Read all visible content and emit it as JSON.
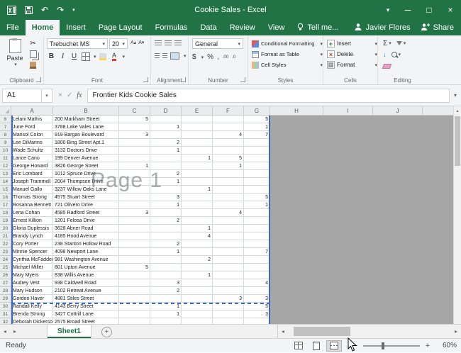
{
  "title_bar": {
    "title": "Cookie Sales - Excel"
  },
  "ribbon_tabs": [
    {
      "label": "File",
      "active": false
    },
    {
      "label": "Home",
      "active": true
    },
    {
      "label": "Insert",
      "active": false
    },
    {
      "label": "Page Layout",
      "active": false
    },
    {
      "label": "Formulas",
      "active": false
    },
    {
      "label": "Data",
      "active": false
    },
    {
      "label": "Review",
      "active": false
    },
    {
      "label": "View",
      "active": false
    }
  ],
  "tell_me": "Tell me...",
  "user_name": "Javier Flores",
  "share_label": "Share",
  "ribbon": {
    "clipboard": {
      "label": "Clipboard",
      "paste_label": "Paste"
    },
    "font": {
      "label": "Font",
      "font_name": "Trebuchet MS",
      "font_size": "20"
    },
    "alignment": {
      "label": "Alignment"
    },
    "number": {
      "label": "Number",
      "format": "General"
    },
    "styles": {
      "label": "Styles",
      "items": [
        "Conditional Formatting",
        "Format as Table",
        "Cell Styles"
      ]
    },
    "cells": {
      "label": "Cells",
      "items": [
        "Insert",
        "Delete",
        "Format"
      ]
    },
    "editing": {
      "label": "Editing"
    }
  },
  "formula_bar": {
    "name_box": "A1",
    "formula": "Frontier Kids Cookie Sales"
  },
  "sheet": {
    "columns": [
      "A",
      "B",
      "C",
      "D",
      "E",
      "F",
      "G",
      "H",
      "I",
      "J"
    ],
    "watermark": "Page 1",
    "page_break_after_row": 29,
    "rows": [
      {
        "n": 6,
        "cells": [
          "Lelani Mathis",
          "200 Markham Street",
          "5",
          "",
          "",
          "",
          "5"
        ]
      },
      {
        "n": 7,
        "cells": [
          "June Ford",
          "3788 Lake Vales Lane",
          "",
          "1",
          "",
          "",
          "1"
        ]
      },
      {
        "n": 8,
        "cells": [
          "Marisol Colon",
          "919 Bargan Boulevard",
          "3",
          "",
          "",
          "4",
          "7"
        ]
      },
      {
        "n": 9,
        "cells": [
          "Lee DiMarino",
          "1800 Bing Street Apt.1",
          "",
          "2",
          "",
          "",
          ""
        ]
      },
      {
        "n": 10,
        "cells": [
          "Wade Schultz",
          "3132 Doctors Drive",
          "",
          "1",
          "",
          "",
          ""
        ]
      },
      {
        "n": 11,
        "cells": [
          "Lance Cano",
          "199 Denver Avenue",
          "",
          "",
          "1",
          "5",
          ""
        ]
      },
      {
        "n": 12,
        "cells": [
          "George Howard",
          "3826 George Street",
          "1",
          "",
          "",
          "1",
          ""
        ]
      },
      {
        "n": 13,
        "cells": [
          "Eric Lombard",
          "1012 Spruce Drive",
          "",
          "2",
          "",
          "",
          ""
        ]
      },
      {
        "n": 14,
        "cells": [
          "Joseph Trammell",
          "2004 Thompson Drive",
          "",
          "1",
          "",
          "",
          ""
        ]
      },
      {
        "n": 15,
        "cells": [
          "Manuel Gallo",
          "3237 Willow Oaks Lane",
          "",
          "",
          "1",
          "",
          ""
        ]
      },
      {
        "n": 16,
        "cells": [
          "Thomas Strong",
          "4575 Stuart Street",
          "",
          "3",
          "",
          "",
          "5"
        ]
      },
      {
        "n": 17,
        "cells": [
          "Rosanna Bennett",
          "721 Olivero Drive",
          "",
          "1",
          "",
          "",
          "1"
        ]
      },
      {
        "n": 18,
        "cells": [
          "Lena Cohan",
          "4585 Radford Street",
          "3",
          "",
          "",
          "4",
          ""
        ]
      },
      {
        "n": 19,
        "cells": [
          "Ernest Killion",
          "1201 Felosa Drive",
          "",
          "2",
          "",
          "",
          ""
        ]
      },
      {
        "n": 20,
        "cells": [
          "Gloria Duplessis",
          "3628 Abner Road",
          "",
          "",
          "1",
          "",
          ""
        ]
      },
      {
        "n": 21,
        "cells": [
          "Brandy Lynch",
          "4185 Hood Avenue",
          "",
          "",
          "4",
          "",
          ""
        ]
      },
      {
        "n": 22,
        "cells": [
          "Cory Porter",
          "238 Stanton Hollow Road",
          "",
          "2",
          "",
          "",
          ""
        ]
      },
      {
        "n": 23,
        "cells": [
          "Minnie Spencer",
          "4098 Newport Lane",
          "",
          "1",
          "",
          "",
          "7"
        ]
      },
      {
        "n": 24,
        "cells": [
          "Cynthia McFadden",
          "981 Washington Avenue",
          "",
          "",
          "2",
          "",
          ""
        ]
      },
      {
        "n": 25,
        "cells": [
          "Michael Miller",
          "801 Upton Avenue",
          "5",
          "",
          "",
          "",
          ""
        ]
      },
      {
        "n": 26,
        "cells": [
          "Mary Myers",
          "838 Willis Avenue",
          "",
          "",
          "1",
          "",
          ""
        ]
      },
      {
        "n": 27,
        "cells": [
          "Audrey Vest",
          "938 Caldwell Road",
          "",
          "3",
          "",
          "",
          "4"
        ]
      },
      {
        "n": 28,
        "cells": [
          "Mary Hudson",
          "2102 Retreat Avenue",
          "",
          "2",
          "",
          "",
          ""
        ]
      },
      {
        "n": 29,
        "cells": [
          "Gordon Haver",
          "4881 Stiles Street",
          "",
          "",
          "",
          "3",
          "3"
        ]
      },
      {
        "n": 30,
        "cells": [
          "Randall Kelly",
          "4143 Berry Street",
          "",
          "1",
          "",
          "",
          "5"
        ]
      },
      {
        "n": 31,
        "cells": [
          "Brenda Strong",
          "3427 Cottrill Lane",
          "",
          "1",
          "",
          "",
          "3"
        ]
      },
      {
        "n": 32,
        "cells": [
          "Deborah Dickerson",
          "2575 Broad Street",
          "",
          "",
          "",
          "",
          ""
        ]
      }
    ]
  },
  "sheet_tabs": {
    "active": "Sheet1"
  },
  "status_bar": {
    "status": "Ready",
    "zoom": "60%"
  },
  "icons": {
    "excel": "X",
    "undo": "↶",
    "redo": "↷",
    "minimize": "─",
    "maximize": "□",
    "close": "×",
    "dropdown": "▾",
    "cut": "✂",
    "bold": "B",
    "italic": "I",
    "underline": "U",
    "font_a": "A",
    "grow_font": "A▴",
    "shrink_font": "A▾",
    "dollar": "$",
    "percent": "%",
    "comma": ",",
    "dec_inc": ".00",
    "dec_dec": ".0",
    "sum": "Σ",
    "fill": "↓",
    "insert_plus": "+",
    "delete_x": "×",
    "format_box": "▦",
    "cancel": "×",
    "enter": "✓",
    "fx": "fx",
    "chevron": "▾",
    "nav_left": "◂",
    "nav_right": "▸",
    "add": "+",
    "scroll_left": "◂",
    "scroll_right": "▸",
    "scroll_up": "▴",
    "zoom_out": "−",
    "zoom_in": "+"
  },
  "colors": {
    "accent_green": "#217346",
    "page_break_blue": "#3a6bc9",
    "outside_area_gray": "#a6a6a6"
  }
}
